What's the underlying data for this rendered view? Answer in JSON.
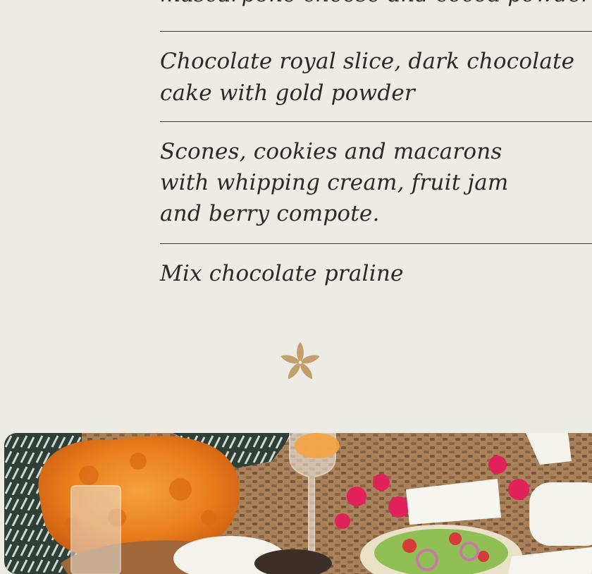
{
  "menu": {
    "items": [
      "mascarpone cheese and cocoa powder",
      "Chocolate royal slice, dark chocolate cake with gold powder",
      "Scones, cookies and macarons with whipping cream, fruit jam and berry compote.",
      "Mix chocolate praline"
    ]
  },
  "ornament": {
    "icon": "plumeria-flower-icon",
    "color": "#c29f6c"
  },
  "photo": {
    "subject": "afternoon-tea-table-photo"
  }
}
